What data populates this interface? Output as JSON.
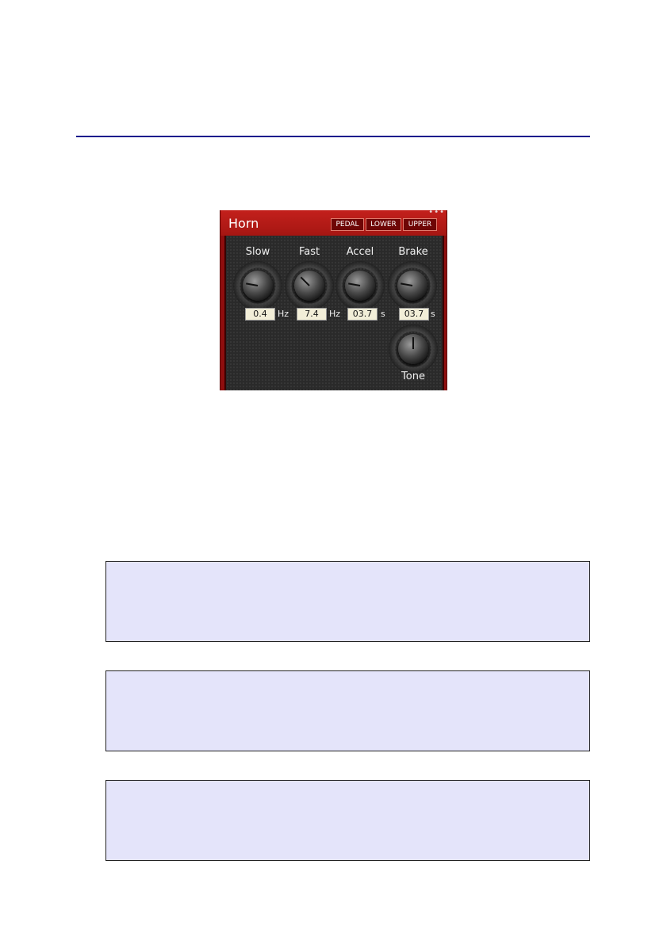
{
  "panel": {
    "title": "Horn",
    "modes": [
      "PEDAL",
      "LOWER",
      "UPPER"
    ],
    "menu_glyph": "•••",
    "knobs": [
      {
        "label": "Slow",
        "value": "0.4",
        "unit": "Hz"
      },
      {
        "label": "Fast",
        "value": "7.4",
        "unit": "Hz"
      },
      {
        "label": "Accel",
        "value": "03.7",
        "unit": "s"
      },
      {
        "label": "Brake",
        "value": "03.7",
        "unit": "s"
      }
    ],
    "tone": {
      "label": "Tone"
    }
  },
  "colors": {
    "panel_red": "#8e0e0e",
    "rule_blue": "#1a1a8c",
    "box_fill": "#e4e4fa"
  }
}
